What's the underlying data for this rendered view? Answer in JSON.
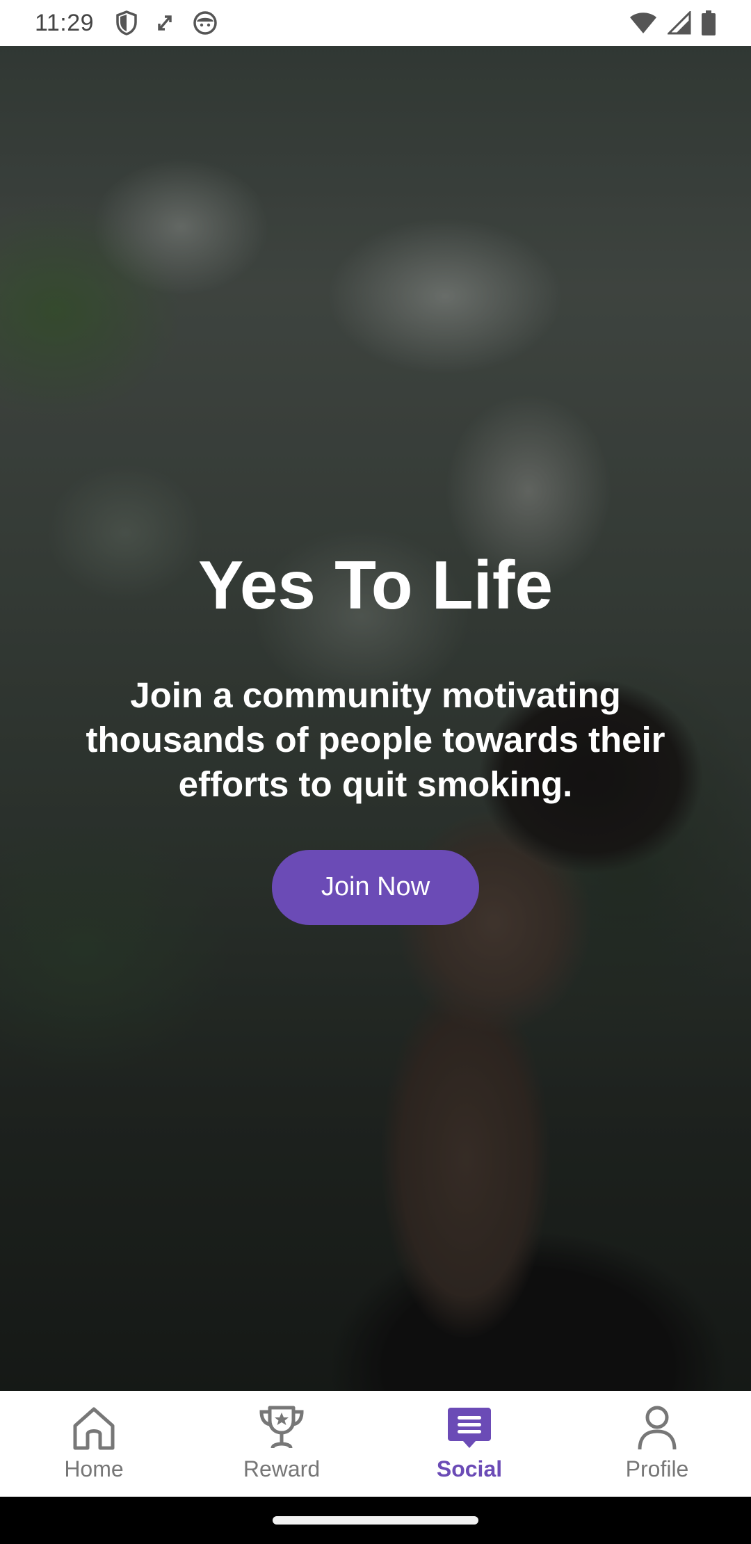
{
  "status_bar": {
    "time": "11:29",
    "left_icons": [
      "shield-icon",
      "sync-icon",
      "android-face-icon"
    ],
    "right_icons": [
      "wifi-icon",
      "cell-signal-icon",
      "battery-icon"
    ]
  },
  "hero": {
    "title": "Yes To Life",
    "subtitle": "Join a community motivating thousands of people towards their efforts to quit smoking.",
    "button_label": "Join Now"
  },
  "bottom_nav": {
    "items": [
      {
        "label": "Home",
        "icon": "home-icon",
        "active": false
      },
      {
        "label": "Reward",
        "icon": "trophy-icon",
        "active": false
      },
      {
        "label": "Social",
        "icon": "social-feed-icon",
        "active": true
      },
      {
        "label": "Profile",
        "icon": "person-icon",
        "active": false
      }
    ]
  },
  "colors": {
    "accent": "#6b4bb6",
    "nav_inactive": "#777777",
    "status_bar_bg": "#ffffff"
  }
}
